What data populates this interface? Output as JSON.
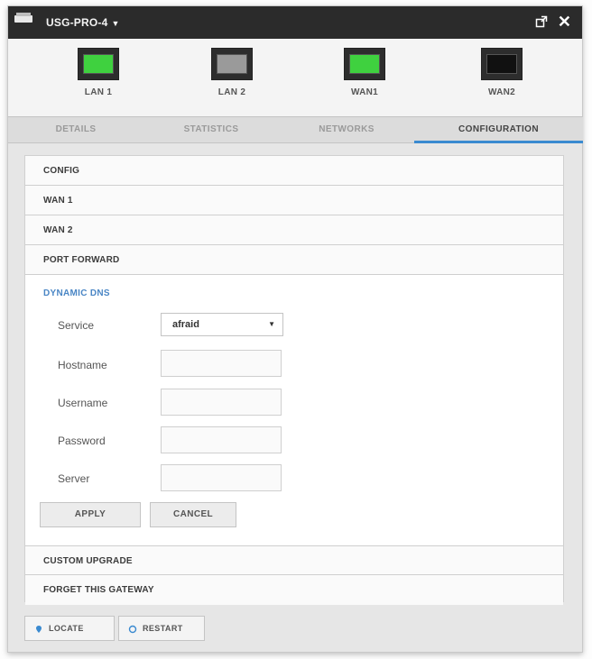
{
  "window": {
    "title": "USG-PRO-4",
    "title_arrow": "▼",
    "close_glyph": "✕"
  },
  "ports": [
    {
      "label": "LAN 1",
      "color": "#3fd13f"
    },
    {
      "label": "LAN 2",
      "color": "#9a9a9a"
    },
    {
      "label": "WAN1",
      "color": "#3fd13f"
    },
    {
      "label": "WAN2",
      "color": "#111111"
    }
  ],
  "tabs": [
    {
      "label": "DETAILS",
      "active": false
    },
    {
      "label": "STATISTICS",
      "active": false
    },
    {
      "label": "NETWORKS",
      "active": false
    },
    {
      "label": "CONFIGURATION",
      "active": true
    }
  ],
  "sections": {
    "config": "CONFIG",
    "wan1": "WAN 1",
    "wan2": "WAN 2",
    "port_forward": "PORT FORWARD",
    "dynamic_dns": "DYNAMIC DNS",
    "custom_upgrade": "CUSTOM UPGRADE",
    "forget_gateway": "FORGET THIS GATEWAY"
  },
  "form": {
    "service_label": "Service",
    "service_value": "afraid",
    "hostname_label": "Hostname",
    "hostname_value": "",
    "username_label": "Username",
    "username_value": "",
    "password_label": "Password",
    "password_value": "",
    "server_label": "Server",
    "server_value": "",
    "apply_label": "APPLY",
    "cancel_label": "CANCEL"
  },
  "footer": {
    "locate_label": "LOCATE",
    "restart_label": "RESTART"
  },
  "colors": {
    "accent": "#3a8ad0",
    "link": "#4a86c5"
  }
}
